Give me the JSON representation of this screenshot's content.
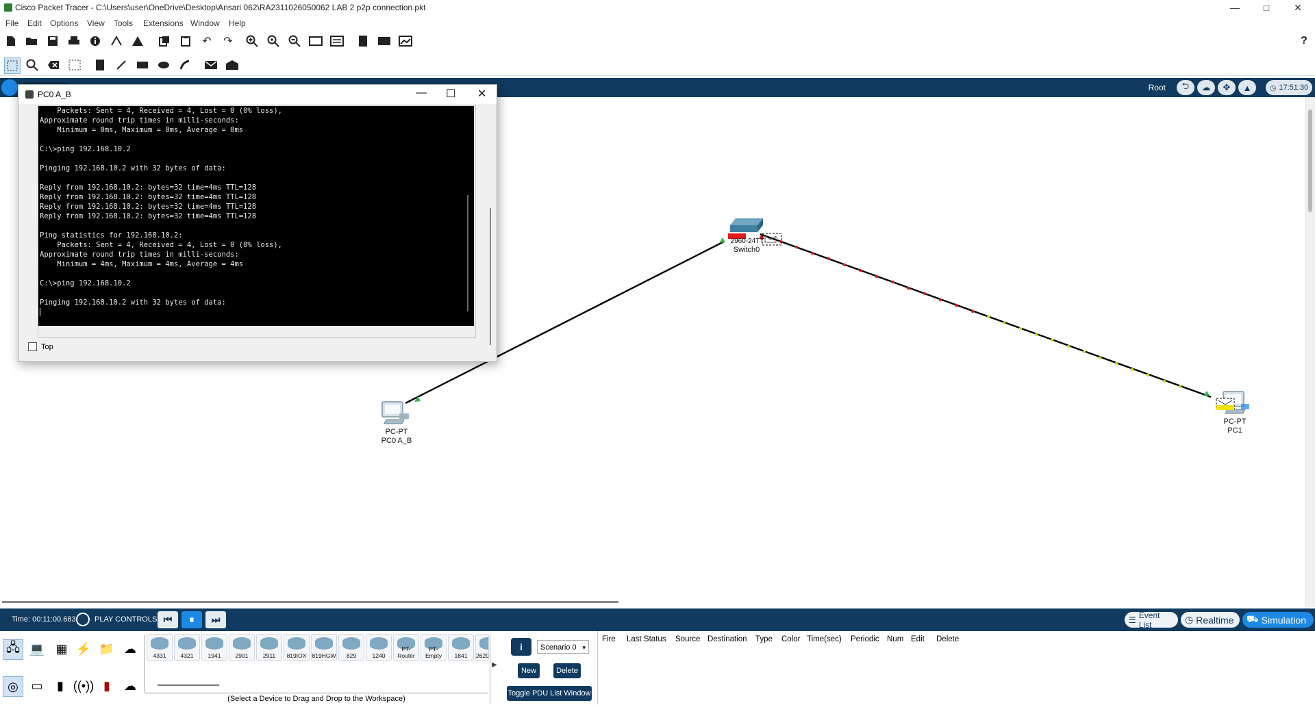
{
  "window": {
    "title": "Cisco Packet Tracer - C:\\Users\\user\\OneDrive\\Desktop\\Ansari 062\\RA2311026050062  LAB 2 p2p connection.pkt",
    "minimize": "—",
    "maximize": "□",
    "close": "✕"
  },
  "menu": [
    "File",
    "Edit",
    "Options",
    "View",
    "Tools",
    "Extensions",
    "Window",
    "Help"
  ],
  "toolbar": {
    "help": "?"
  },
  "workspace_bar": {
    "root": "Root",
    "clock": "17:51:30"
  },
  "devices": {
    "switch0": {
      "model": "2960-24TT",
      "name": "Switch0"
    },
    "pc0": {
      "model": "PC-PT",
      "name": "PC0 A_B"
    },
    "pc1": {
      "model": "PC-PT",
      "name": "PC1"
    }
  },
  "pc0_window": {
    "title": "PC0 A_B",
    "minimize": "—",
    "maximize": "☐",
    "close": "✕",
    "top_checkbox": "Top",
    "terminal_lines": [
      "    Packets: Sent = 4, Received = 4, Lost = 0 (0% loss),",
      "Approximate round trip times in milli-seconds:",
      "    Minimum = 0ms, Maximum = 0ms, Average = 0ms",
      "",
      "C:\\>ping 192.168.10.2",
      "",
      "Pinging 192.168.10.2 with 32 bytes of data:",
      "",
      "Reply from 192.168.10.2: bytes=32 time=4ms TTL=128",
      "Reply from 192.168.10.2: bytes=32 time=4ms TTL=128",
      "Reply from 192.168.10.2: bytes=32 time=4ms TTL=128",
      "Reply from 192.168.10.2: bytes=32 time=4ms TTL=128",
      "",
      "Ping statistics for 192.168.10.2:",
      "    Packets: Sent = 4, Received = 4, Lost = 0 (0% loss),",
      "Approximate round trip times in milli-seconds:",
      "    Minimum = 4ms, Maximum = 4ms, Average = 4ms",
      "",
      "C:\\>ping 192.168.10.2",
      "",
      "Pinging 192.168.10.2 with 32 bytes of data:",
      ""
    ]
  },
  "simulation_bar": {
    "time": "Time: 00:11:00.683",
    "play_controls": "PLAY CONTROLS:",
    "back": "⏮",
    "pause": "⏸",
    "forward": "⏭",
    "event_list": "Event List",
    "realtime": "Realtime",
    "simulation": "Simulation"
  },
  "device_panel": {
    "models": [
      "4331",
      "4321",
      "1941",
      "2901",
      "2911",
      "819IOX",
      "819HGW",
      "829",
      "1240",
      "PT-Router",
      "PT-Empty",
      "1841",
      "2620"
    ],
    "select_message": "(Select a Device to Drag and Drop to the Workspace)"
  },
  "scenario": {
    "info": "i",
    "selected": "Scenario 0",
    "new": "New",
    "delete": "Delete",
    "toggle": "Toggle PDU List Window"
  },
  "pdu_columns": [
    "Fire",
    "Last Status",
    "Source",
    "Destination",
    "Type",
    "Color",
    "Time(sec)",
    "Periodic",
    "Num",
    "Edit",
    "Delete"
  ]
}
